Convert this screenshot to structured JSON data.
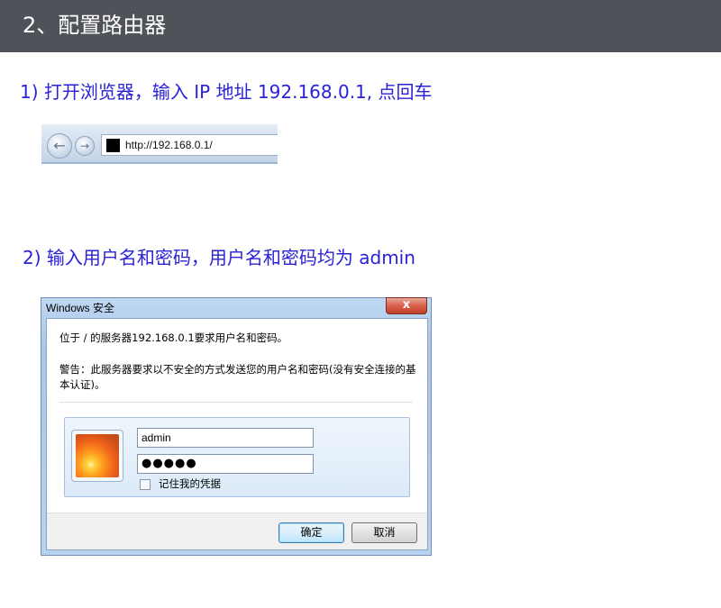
{
  "header": {
    "title": "2、配置路由器"
  },
  "steps": {
    "step1": "1) 打开浏览器，输入 IP 地址 192.168.0.1, 点回车",
    "step2": "2) 输入用户名和密码，用户名和密码均为 admin"
  },
  "browser": {
    "address": "http://192.168.0.1/",
    "back_glyph": "←",
    "forward_glyph": "→"
  },
  "dialog": {
    "title": "Windows 安全",
    "close_glyph": "x",
    "message": "位于 / 的服务器192.168.0.1要求用户名和密码。",
    "warning": "警告：此服务器要求以不安全的方式发送您的用户名和密码(没有安全连接的基本认证)。",
    "username_value": "admin",
    "password_value": "●●●●●",
    "remember_label": "记住我的凭据",
    "remember_checked": false,
    "ok_label": "确定",
    "cancel_label": "取消"
  },
  "colors": {
    "header_bg": "#4f5258",
    "step_text": "#2a22d6"
  }
}
